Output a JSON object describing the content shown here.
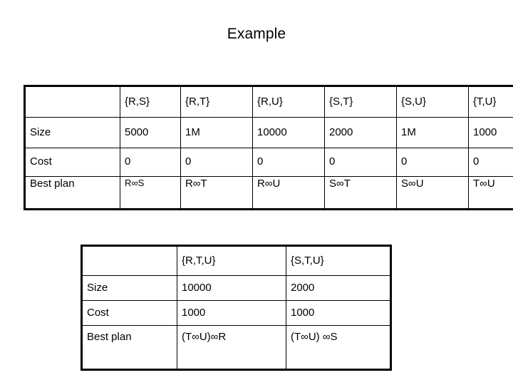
{
  "slide": {
    "title": "Example"
  },
  "table_pairs": {
    "name": "two-relation-subsets",
    "columns": [
      "",
      "{R,S}",
      "{R,T}",
      "{R,U}",
      "{S,T}",
      "{S,U}",
      "{T,U}"
    ],
    "rows": [
      {
        "label": "Size",
        "values": [
          "5000",
          "1M",
          "10000",
          "2000",
          "1M",
          "1000"
        ]
      },
      {
        "label": "Cost",
        "values": [
          "0",
          "0",
          "0",
          "0",
          "0",
          "0"
        ]
      },
      {
        "label": "Best plan",
        "values": [
          "R∞S",
          "R∞T",
          "R∞U",
          "S∞T",
          "S∞U",
          "T∞U"
        ]
      }
    ]
  },
  "table_triples": {
    "name": "three-relation-subsets",
    "columns": [
      "",
      "{R,T,U}",
      "{S,T,U}"
    ],
    "rows": [
      {
        "label": "Size",
        "values": [
          "10000",
          "2000"
        ]
      },
      {
        "label": "Cost",
        "values": [
          "1000",
          "1000"
        ]
      },
      {
        "label": "Best plan",
        "values": [
          "(T∞U)∞R",
          "(T∞U) ∞S"
        ]
      }
    ]
  },
  "colors": {
    "background": "#ffffff",
    "text": "#000000",
    "border": "#000000"
  }
}
